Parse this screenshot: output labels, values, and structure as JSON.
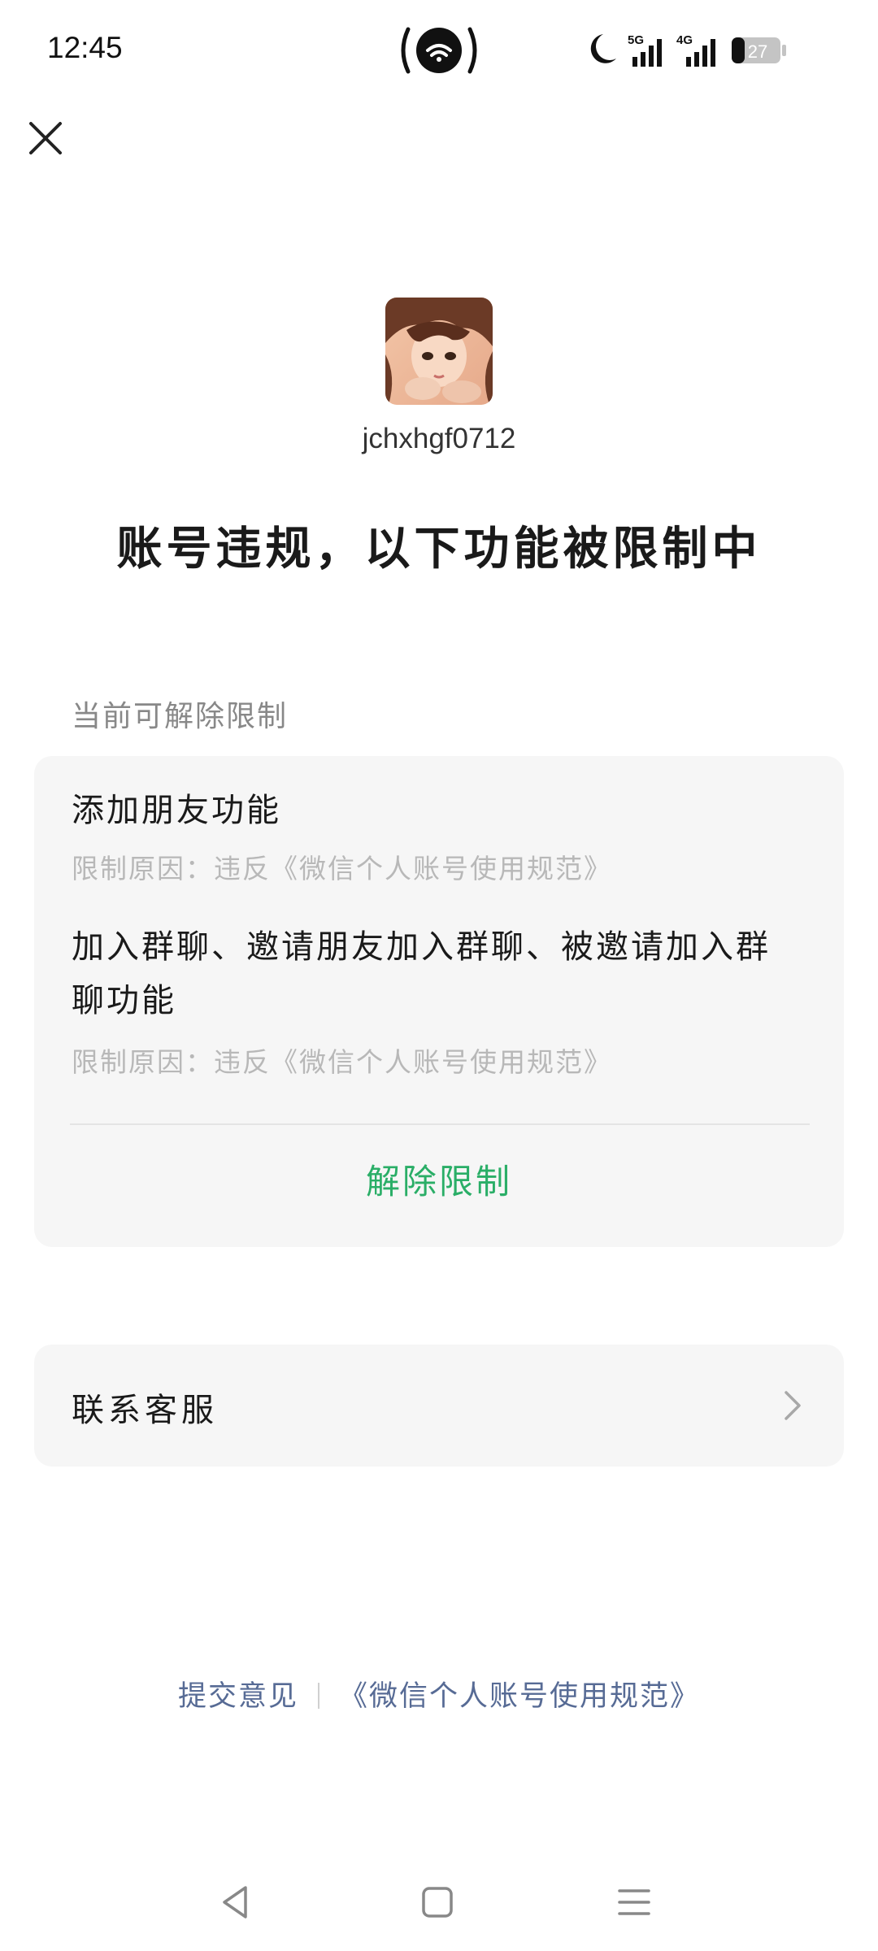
{
  "status_bar": {
    "time": "12:45",
    "network_1": "5G",
    "network_2": "4G",
    "battery": "27"
  },
  "profile": {
    "username": "jchxhgf0712"
  },
  "headline": "账号违规，以下功能被限制中",
  "section_label": "当前可解除限制",
  "restrictions": [
    {
      "title": "添加朋友功能",
      "reason": "限制原因：违反《微信个人账号使用规范》"
    },
    {
      "title": "加入群聊、邀请朋友加入群聊、被邀请加入群聊功能",
      "reason": "限制原因：违反《微信个人账号使用规范》"
    }
  ],
  "unlock_label": "解除限制",
  "contact_label": "联系客服",
  "footer": {
    "feedback": "提交意见",
    "policy": "《微信个人账号使用规范》"
  },
  "colors": {
    "accent_green": "#2aae67",
    "link_blue": "#576b95",
    "card_bg": "#f6f6f6"
  },
  "icons": [
    "close-icon",
    "hotspot-icon",
    "moon-icon",
    "signal-icon",
    "battery-icon",
    "chevron-right-icon",
    "back-icon",
    "home-icon",
    "menu-icon"
  ]
}
